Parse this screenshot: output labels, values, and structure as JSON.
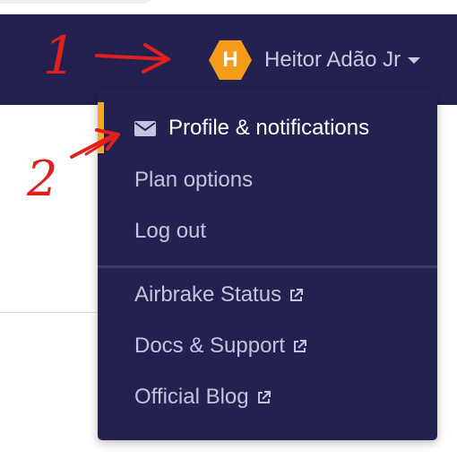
{
  "header": {
    "avatar_letter": "H",
    "user_name": "Heitor Adão Jr"
  },
  "dropdown": {
    "account_items": [
      {
        "label": "Profile & notifications",
        "icon": "envelope-icon",
        "active": true
      },
      {
        "label": "Plan options"
      },
      {
        "label": "Log out"
      }
    ],
    "external_links": [
      {
        "label": "Airbrake Status",
        "icon": "external-link-icon"
      },
      {
        "label": "Docs & Support",
        "icon": "external-link-icon"
      },
      {
        "label": "Official Blog",
        "icon": "external-link-icon"
      }
    ]
  },
  "annotations": {
    "step_1": "1",
    "step_2": "2"
  },
  "colors": {
    "navbar": "#232150",
    "accent": "#f5a623",
    "avatar": "#f59c1b",
    "annotation": "#e0201d"
  }
}
